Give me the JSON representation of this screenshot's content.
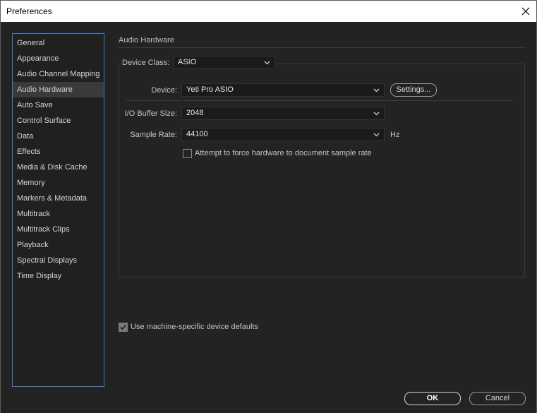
{
  "window": {
    "title": "Preferences"
  },
  "sidebar": {
    "items": [
      {
        "label": "General"
      },
      {
        "label": "Appearance"
      },
      {
        "label": "Audio Channel Mapping"
      },
      {
        "label": "Audio Hardware",
        "active": true
      },
      {
        "label": "Auto Save"
      },
      {
        "label": "Control Surface"
      },
      {
        "label": "Data"
      },
      {
        "label": "Effects"
      },
      {
        "label": "Media & Disk Cache"
      },
      {
        "label": "Memory"
      },
      {
        "label": "Markers & Metadata"
      },
      {
        "label": "Multitrack"
      },
      {
        "label": "Multitrack Clips"
      },
      {
        "label": "Playback"
      },
      {
        "label": "Spectral Displays"
      },
      {
        "label": "Time Display"
      }
    ]
  },
  "panel": {
    "title": "Audio Hardware",
    "device_class": {
      "label": "Device Class:",
      "value": "ASIO"
    },
    "device": {
      "label": "Device:",
      "value": "Yeti Pro ASIO",
      "settings_label": "Settings..."
    },
    "buffer": {
      "label": "I/O Buffer Size:",
      "value": "2048"
    },
    "sample_rate": {
      "label": "Sample Rate:",
      "value": "44100",
      "unit": "Hz"
    },
    "force_rate": {
      "label": "Attempt to force hardware to document sample rate",
      "checked": false
    },
    "machine_defaults": {
      "label": "Use machine-specific device defaults",
      "checked": true
    }
  },
  "footer": {
    "ok_label": "OK",
    "cancel_label": "Cancel"
  },
  "colors": {
    "background": "#232323",
    "accent": "#3f7cc2",
    "active_item": "#3a3a3a"
  }
}
